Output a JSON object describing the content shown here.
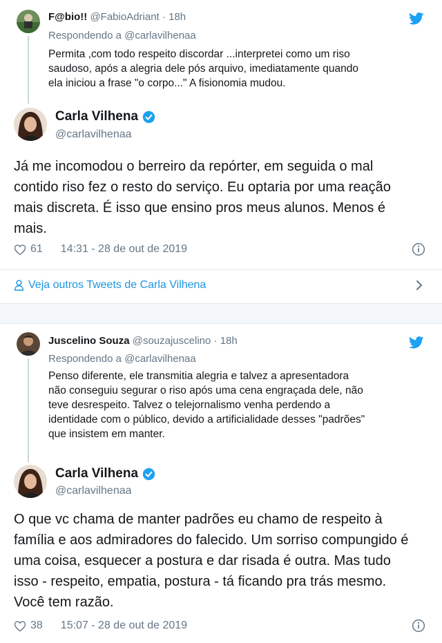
{
  "tweet1": {
    "reply": {
      "name": "F@bio!!",
      "handle": "@FabioAdriant",
      "time": "18h",
      "replying_prefix": "Respondendo a",
      "replying_to": "@carlavilhenaa",
      "text_lines": [
        "Permita ,com todo respeito discordar ...interpretei como um riso",
        "saudoso, após a alegria dele pós arquivo,  imediatamente quando",
        "ela iniciou a frase \"o corpo...\" A fisionomia mudou."
      ]
    },
    "main": {
      "name": "Carla Vilhena",
      "handle": "@carlavilhenaa",
      "text_lines": [
        "Já me incomodou o berreiro da repórter, em seguida o mal",
        "contido riso fez o resto do serviço. Eu optaria por uma reação",
        "mais discreta. É isso que ensino pros meus alunos. Menos é",
        "mais."
      ],
      "likes": "61",
      "timestamp": "14:31 - 28 de out de 2019"
    },
    "more_tweets": "Veja outros Tweets de Carla Vilhena"
  },
  "tweet2": {
    "reply": {
      "name": "Juscelino Souza",
      "handle": "@souzajuscelino",
      "time": "18h",
      "replying_prefix": "Respondendo a",
      "replying_to": "@carlavilhenaa",
      "text_lines": [
        "Penso diferente, ele transmitia alegria e talvez a apresentadora",
        "não conseguiu segurar o riso após uma cena engraçada dele, não",
        "teve  desrespeito. Talvez o telejornalismo venha perdendo a",
        "identidade com o público, devido a artificialidade desses \"padrões\"",
        "que insistem em manter."
      ]
    },
    "main": {
      "name": "Carla Vilhena",
      "handle": "@carlavilhenaa",
      "text_lines": [
        "O que vc chama de manter padrões eu chamo de respeito à",
        "família e aos admiradores do falecido. Um sorriso compungido é",
        "uma coisa, esquecer a postura e dar risada é outra. Mas tudo",
        "isso - respeito, empatia, postura - tá ficando pra trás mesmo.",
        "Você tem razão."
      ],
      "likes": "38",
      "timestamp": "15:07 - 28 de out de 2019"
    }
  },
  "colors": {
    "twitter_blue": "#1da1f2",
    "link_blue": "#1b95e0",
    "secondary_text": "#657786",
    "primary_text": "#14171a",
    "divider": "#e1e8ed"
  },
  "icons": {
    "bird": "twitter-bird-icon",
    "verified": "verified-badge-icon",
    "heart": "heart-icon",
    "info": "info-icon",
    "person": "person-icon",
    "chevron": "chevron-right-icon"
  }
}
